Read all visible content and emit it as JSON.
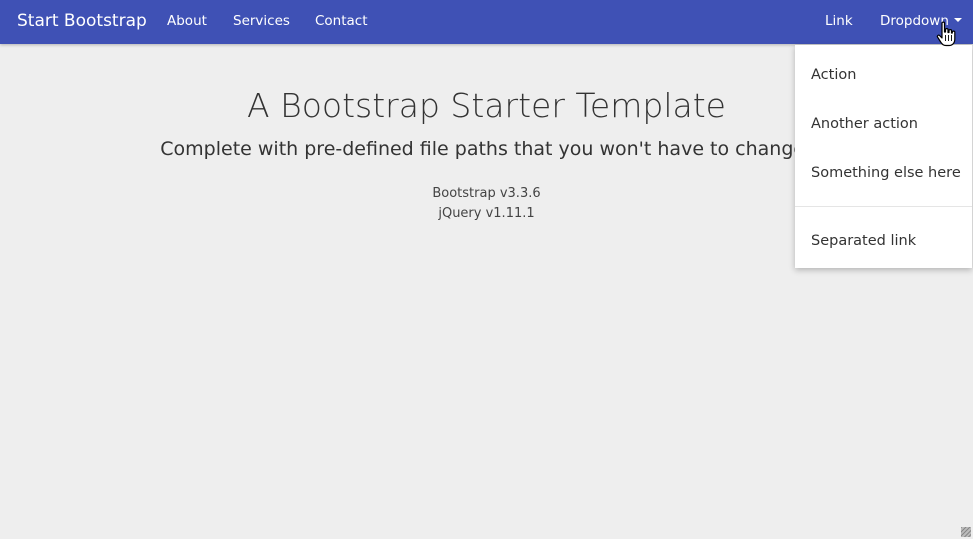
{
  "navbar": {
    "brand": "Start Bootstrap",
    "links_left": [
      "About",
      "Services",
      "Contact"
    ],
    "link_right": "Link",
    "dropdown_label": "Dropdown",
    "color": "#3f51b5"
  },
  "hero": {
    "title": "A Bootstrap Starter Template",
    "subtitle": "Complete with pre-defined file paths that you won't have to change!",
    "versions": [
      "Bootstrap v3.3.6",
      "jQuery v1.11.1"
    ]
  },
  "dropdown_menu": {
    "items": [
      "Action",
      "Another action",
      "Something else here"
    ],
    "separated_item": "Separated link"
  },
  "icons": {
    "caret": "caret-down-icon",
    "cursor": "hand-pointer-icon"
  }
}
